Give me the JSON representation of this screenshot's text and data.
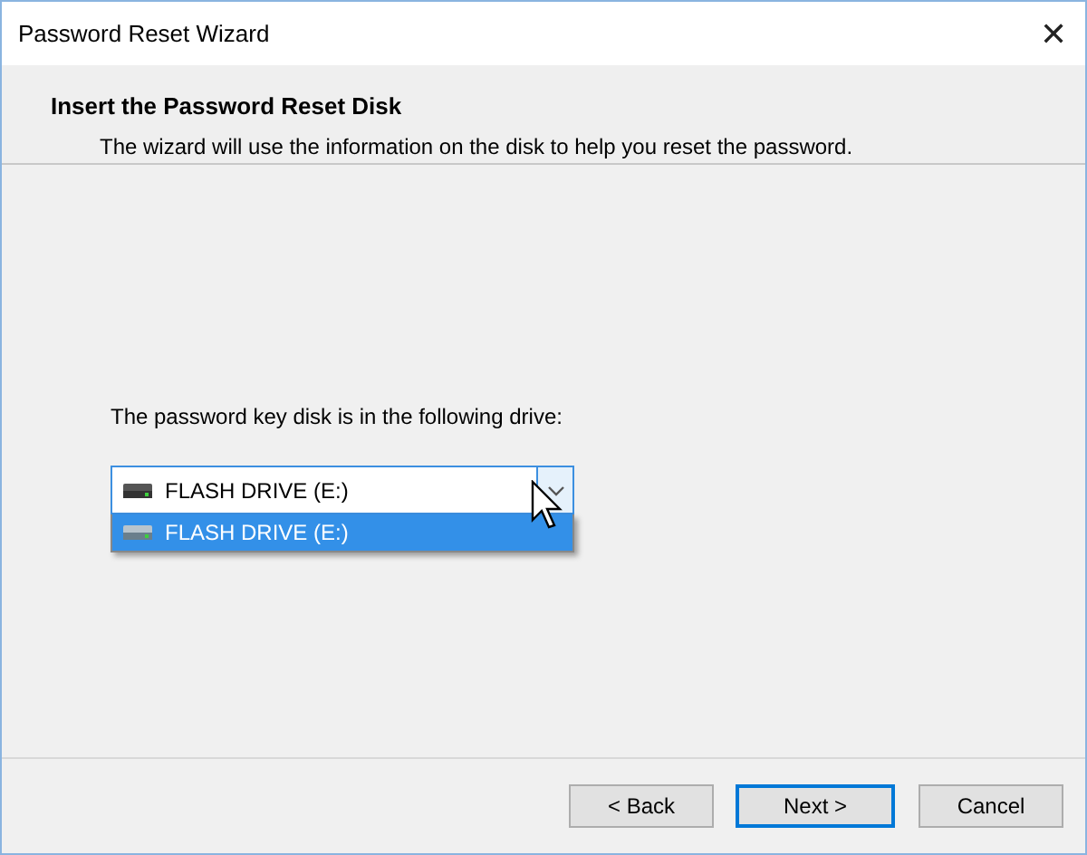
{
  "window": {
    "title": "Password Reset Wizard",
    "close": "✕"
  },
  "header": {
    "title": "Insert the Password Reset Disk",
    "subtitle": "The wizard will use the information on the disk to help you reset the password."
  },
  "drive_label": "The password key disk is in the following drive:",
  "drive_select": {
    "value": "FLASH DRIVE (E:)",
    "expanded": true,
    "options": [
      {
        "label": "FLASH DRIVE (E:)",
        "selected": true
      }
    ]
  },
  "buttons": [
    {
      "label": "< Back",
      "default": false
    },
    {
      "label": "Next >",
      "default": true
    },
    {
      "label": "Cancel",
      "default": false
    }
  ]
}
